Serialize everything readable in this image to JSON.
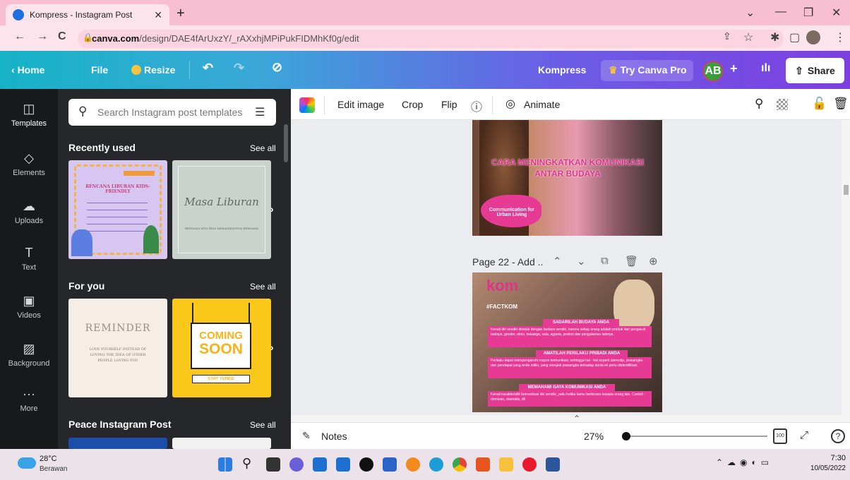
{
  "browser": {
    "tab_title": "Kompress - Instagram Post",
    "url_host": "canva.com",
    "url_path": "/design/DAE4fArUxzY/_rAXxhjMPiPukFIDMhKf0g/edit"
  },
  "header": {
    "home": "Home",
    "file": "File",
    "resize": "Resize",
    "doc_title": "Kompress",
    "try_pro": "Try Canva Pro",
    "avatar": "AB",
    "share": "Share"
  },
  "rail": {
    "items": [
      {
        "label": "Templates",
        "icon": "templates-icon"
      },
      {
        "label": "Elements",
        "icon": "elements-icon"
      },
      {
        "label": "Uploads",
        "icon": "uploads-icon"
      },
      {
        "label": "Text",
        "icon": "text-icon"
      },
      {
        "label": "Videos",
        "icon": "videos-icon"
      },
      {
        "label": "Background",
        "icon": "background-icon"
      },
      {
        "label": "More",
        "icon": "more-icon"
      }
    ]
  },
  "panel": {
    "search_placeholder": "Search Instagram post templates",
    "recently_used": "Recently used",
    "for_you": "For you",
    "peace": "Peace Instagram Post",
    "see_all": "See all",
    "thumb1_title": "RENCANA LIBURAN KIDS-FRIENDLY",
    "thumb2_title": "Masa Liburan",
    "thumb2_sub": "BERSAMA KITA BISA MERAYAKANNYA BERSAMA",
    "thumb3_title": "REMINDER",
    "thumb3_sub": "LOVE YOURSELF INSTEAD OF LOVING THE IDEA OF OTHER PEOPLE LOVING YOU",
    "thumb4_line1": "COMING",
    "thumb4_line2": "SOON",
    "thumb4_sub": "STAY TUNED"
  },
  "toolbar": {
    "edit_image": "Edit image",
    "crop": "Crop",
    "flip": "Flip",
    "animate": "Animate"
  },
  "canvas": {
    "p21_title": "CARA MENINGKATKAN KOMUNIKASI ANTAR BUDAYA",
    "p21_tag": "Communication for Urban Living",
    "page_label": "Page 22 - Add ..",
    "p22_logo": "kom",
    "p22_hashtag": "#FACTKOM",
    "p22_h1": "SADARILAH BUDAYA ANDA",
    "p22_b1": "Kenali diri sendiri dimulai dengan budaya sendiri, karena setiap orang adalah produk dari pengaruh budaya, gender, etnis, keluarga, usia, agama, profesi dan pengalaman lainnya.",
    "p22_h2": "AMATILAH PERILAKU PRIBADI ANDA",
    "p22_b2": "Perilaku dapat mempengaruhi respon komunikasi, sehingga hal - hal seperti stereotip, prasangka dan pendapat yang anda miliki, yang menjadi prasangka terhadap dunia ini perlu diidentifikasi.",
    "p22_h3": "MEMAHAMI GAYA KOMUNIKASI ANDA",
    "p22_b3": "Kenali karakteristik komunikasi diri sendiri, yaitu ketika kamu berbicara kepada orang lain. Contoh : dominan, dramatis, dll"
  },
  "bottom": {
    "notes": "Notes",
    "zoom": "27%",
    "zoom_fraction": 0.27
  },
  "taskbar": {
    "temp": "28°C",
    "weather": "Berawan",
    "time": "7:30",
    "date": "10/05/2022"
  }
}
